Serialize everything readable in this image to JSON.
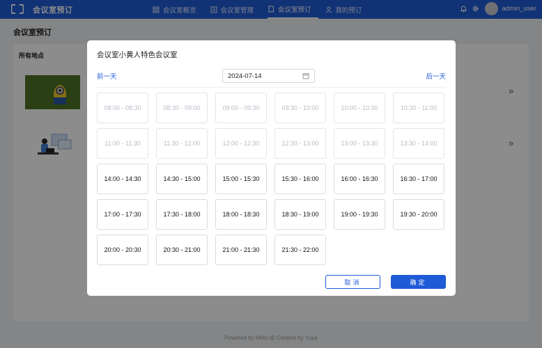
{
  "header": {
    "app_title": "会议室预订",
    "nav": [
      {
        "label": "会议室概览",
        "icon": "grid-icon",
        "active": false
      },
      {
        "label": "会议室管理",
        "icon": "manage-icon",
        "active": false
      },
      {
        "label": "会议室预订",
        "icon": "document-icon",
        "active": true
      },
      {
        "label": "我的预订",
        "icon": "user-icon",
        "active": false
      }
    ],
    "username": "admin_user"
  },
  "page": {
    "title": "会议室预订",
    "card_title": "所有地点",
    "footer": "Powered by Mobi @ Created by Yuya"
  },
  "modal": {
    "title": "会议室小黄人特色会议室",
    "prev_day": "前一天",
    "next_day": "后一天",
    "date": "2024-07-14",
    "slots": [
      {
        "label": "08:00 - 08:30",
        "disabled": true
      },
      {
        "label": "08:30 - 09:00",
        "disabled": true
      },
      {
        "label": "09:00 - 09:30",
        "disabled": true
      },
      {
        "label": "09:30 - 10:00",
        "disabled": true
      },
      {
        "label": "10:00 - 10:30",
        "disabled": true
      },
      {
        "label": "10:30 - 11:00",
        "disabled": true
      },
      {
        "label": "11:00 - 11:30",
        "disabled": true
      },
      {
        "label": "11:30 - 12:00",
        "disabled": true
      },
      {
        "label": "12:00 - 12:30",
        "disabled": true
      },
      {
        "label": "12:30 - 13:00",
        "disabled": true
      },
      {
        "label": "13:00 - 13:30",
        "disabled": true
      },
      {
        "label": "13:30 - 14:00",
        "disabled": true
      },
      {
        "label": "14:00 - 14:30",
        "disabled": false
      },
      {
        "label": "14:30 - 15:00",
        "disabled": false
      },
      {
        "label": "15:00 - 15:30",
        "disabled": false
      },
      {
        "label": "15:30 - 16:00",
        "disabled": false
      },
      {
        "label": "16:00 - 16:30",
        "disabled": false
      },
      {
        "label": "16:30 - 17:00",
        "disabled": false
      },
      {
        "label": "17:00 - 17:30",
        "disabled": false
      },
      {
        "label": "17:30 - 18:00",
        "disabled": false
      },
      {
        "label": "18:00 - 18:30",
        "disabled": false
      },
      {
        "label": "18:30 - 19:00",
        "disabled": false
      },
      {
        "label": "19:00 - 19:30",
        "disabled": false
      },
      {
        "label": "19:30 - 20:00",
        "disabled": false
      },
      {
        "label": "20:00 - 20:30",
        "disabled": false
      },
      {
        "label": "20:30 - 21:00",
        "disabled": false
      },
      {
        "label": "21:00 - 21:30",
        "disabled": false
      },
      {
        "label": "21:30 - 22:00",
        "disabled": false
      }
    ],
    "cancel_label": "取消",
    "ok_label": "确定"
  },
  "colors": {
    "primary": "#1f5bd6",
    "disabled_text": "#b8bcc5"
  }
}
